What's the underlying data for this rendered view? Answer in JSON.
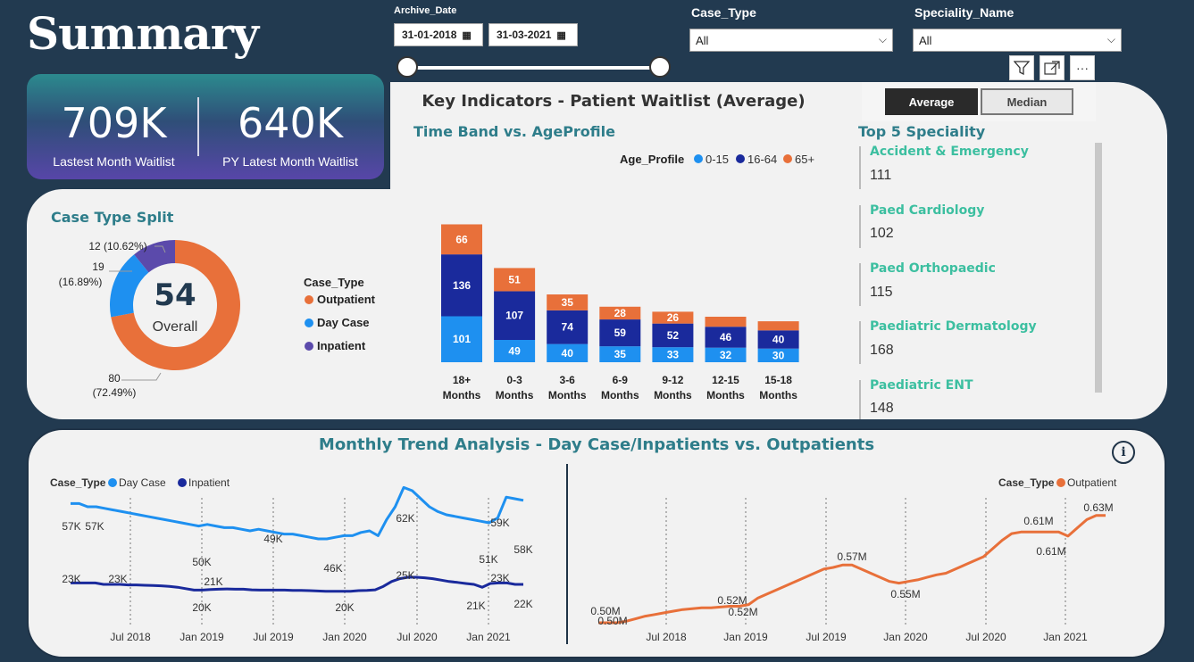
{
  "title": "Summary",
  "slicers": {
    "archive_label": "Archive_Date",
    "date_from": "31-01-2018",
    "date_to": "31-03-2021",
    "case_type_label": "Case_Type",
    "case_type_value": "All",
    "speciality_label": "Speciality_Name",
    "speciality_value": "All"
  },
  "kpis": [
    {
      "value": "709K",
      "label": "Lastest Month Waitlist"
    },
    {
      "value": "640K",
      "label": "PY Latest Month Waitlist"
    }
  ],
  "toggle": {
    "active": "Average",
    "inactive": "Median"
  },
  "key_indicators_title": "Key Indicators - Patient Waitlist (Average)",
  "colors": {
    "outpatient": "#e8703a",
    "daycase": "#1e90f0",
    "inpatient": "#5b4aab",
    "age_0_15": "#1e90f0",
    "age_16_64": "#1a2a9c",
    "age_65": "#e8703a",
    "teal": "#2e7d8a",
    "green": "#3cbfa0"
  },
  "chart_data": [
    {
      "type": "pie",
      "title": "Case Type Split",
      "center_value": "54",
      "center_label": "Overall",
      "legend_title": "Case_Type",
      "slices": [
        {
          "name": "Outpatient",
          "value": 80,
          "pct": "72.49%",
          "color": "#e8703a"
        },
        {
          "name": "Day Case",
          "value": 19,
          "pct": "16.89%",
          "color": "#1e90f0"
        },
        {
          "name": "Inpatient",
          "value": 12,
          "pct": "10.62%",
          "color": "#5b4aab"
        }
      ]
    },
    {
      "type": "bar",
      "title": "Time Band vs. AgeProfile",
      "legend_title": "Age_Profile",
      "categories": [
        "18+ Months",
        "0-3 Months",
        "3-6 Months",
        "6-9 Months",
        "9-12 Months",
        "12-15 Months",
        "15-18 Months"
      ],
      "series": [
        {
          "name": "0-15",
          "values": [
            101,
            49,
            40,
            35,
            33,
            32,
            30
          ],
          "color": "#1e90f0"
        },
        {
          "name": "16-64",
          "values": [
            136,
            107,
            74,
            59,
            52,
            46,
            40
          ],
          "color": "#1a2a9c"
        },
        {
          "name": "65+",
          "values": [
            66,
            51,
            35,
            28,
            26,
            22,
            20
          ],
          "color": "#e8703a"
        }
      ]
    },
    {
      "type": "table",
      "title": "Top 5 Speciality",
      "rows": [
        {
          "name": "Accident & Emergency",
          "value": "111"
        },
        {
          "name": "Paed Cardiology",
          "value": "102"
        },
        {
          "name": "Paed Orthopaedic",
          "value": "115"
        },
        {
          "name": "Paediatric Dermatology",
          "value": "168"
        },
        {
          "name": "Paediatric ENT",
          "value": "148"
        }
      ]
    },
    {
      "type": "line",
      "title": "Monthly Trend Analysis - Day Case/Inpatients vs. Outpatients",
      "legend_title": "Case_Type",
      "x_ticks": [
        "Jul 2018",
        "Jan 2019",
        "Jul 2019",
        "Jan 2020",
        "Jul 2020",
        "Jan 2021"
      ],
      "series": [
        {
          "name": "Day Case",
          "color": "#1e90f0",
          "values": [
            57,
            57,
            56,
            56,
            55.5,
            55,
            54.5,
            54,
            53.5,
            53,
            52.5,
            52,
            51.5,
            51,
            50.5,
            50,
            50.5,
            50,
            49.5,
            49.5,
            49,
            48.5,
            49,
            48.5,
            48,
            47.5,
            47.5,
            47,
            46.5,
            46,
            46,
            46.5,
            47,
            47,
            48,
            48.5,
            47,
            52,
            56,
            62,
            61,
            58.5,
            56,
            54.5,
            53.5,
            53,
            52.5,
            52,
            51.5,
            51,
            52.5,
            59,
            58.5,
            58
          ]
        },
        {
          "name": "Inpatient",
          "color": "#1a2a9c",
          "values": [
            23,
            23,
            23,
            23,
            22.5,
            22.5,
            22.5,
            22.3,
            22.3,
            22.2,
            22.1,
            22,
            21.8,
            21.5,
            21,
            20.5,
            20.5,
            20.7,
            20.8,
            20.9,
            20.8,
            20.8,
            20.6,
            20.5,
            20.5,
            20.5,
            20.5,
            20.4,
            20.4,
            20.3,
            20.2,
            20.1,
            20.1,
            20.1,
            20.1,
            20.3,
            20.4,
            20.6,
            21.8,
            23.5,
            24.5,
            25,
            25,
            24.8,
            24.5,
            24,
            23.5,
            23.2,
            22.8,
            22.5,
            21.5,
            22.8,
            23,
            23,
            22.5,
            22.5
          ]
        },
        {
          "name": "Outpatient",
          "color": "#e8703a",
          "values": [
            0.5,
            0.5,
            0.5,
            0.502,
            0.505,
            0.508,
            0.51,
            0.512,
            0.514,
            0.516,
            0.517,
            0.518,
            0.518,
            0.519,
            0.52,
            0.52,
            0.522,
            0.53,
            0.535,
            0.54,
            0.545,
            0.55,
            0.555,
            0.56,
            0.565,
            0.567,
            0.57,
            0.57,
            0.565,
            0.56,
            0.555,
            0.55,
            0.548,
            0.55,
            0.552,
            0.555,
            0.558,
            0.56,
            0.565,
            0.57,
            0.575,
            0.58,
            0.59,
            0.6,
            0.608,
            0.61,
            0.61,
            0.61,
            0.61,
            0.61,
            0.605,
            0.615,
            0.625,
            0.63,
            0.63
          ]
        }
      ],
      "point_labels_left": [
        "57K",
        "57K",
        "50K",
        "49K",
        "46K",
        "62K",
        "51K",
        "59K",
        "58K",
        "23K",
        "23K",
        "20K",
        "21K",
        "20K",
        "25K",
        "21K",
        "23K",
        "22K"
      ],
      "point_labels_right": [
        "0.50M",
        "0.50M",
        "0.52M",
        "0.52M",
        "0.57M",
        "0.55M",
        "0.61M",
        "0.61M",
        "0.63M"
      ]
    }
  ]
}
